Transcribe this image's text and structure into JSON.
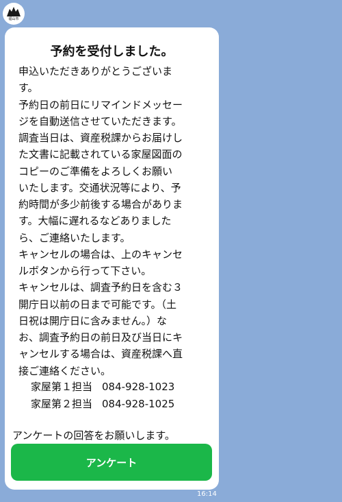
{
  "sender": {
    "avatar_label": "福山市",
    "icon": "castle-logo-icon"
  },
  "message": {
    "title": "予約を受付しました。",
    "body_lines": [
      "申込いただきありがとうございま",
      "す。",
      "予約日の前日にリマインドメッセー",
      "ジを自動送信させていただきます。",
      "調査当日は、資産税課からお届けし",
      "た文書に記載されている家屋図面の",
      "コピーのご準備をよろしくお願い",
      "いたします。交通状況等により、予",
      "約時間が多少前後する場合がありま",
      "す。大幅に遅れるなどありました",
      "ら、ご連絡いたします。",
      "キャンセルの場合は、上のキャンセ",
      "ルボタンから行って下さい。",
      "キャンセルは、調査予約日を含む３",
      "開庁日以前の日まで可能です。（土",
      "日祝は開庁日に含みません。）な",
      "お、調査予約日の前日及び当日にキ",
      "ャンセルする場合は、資産税課へ直",
      "接ご連絡ください。"
    ],
    "contacts": [
      {
        "label": "家屋第１担当",
        "phone": "084-928-1023"
      },
      {
        "label": "家屋第２担当",
        "phone": "084-928-1025"
      }
    ],
    "survey_note": "アンケートの回答をお願いします。",
    "survey_button_label": "アンケート",
    "time": "16:14"
  },
  "colors": {
    "background": "#8aabd8",
    "bubble": "#ffffff",
    "button": "#1bb749",
    "text": "#111111"
  }
}
